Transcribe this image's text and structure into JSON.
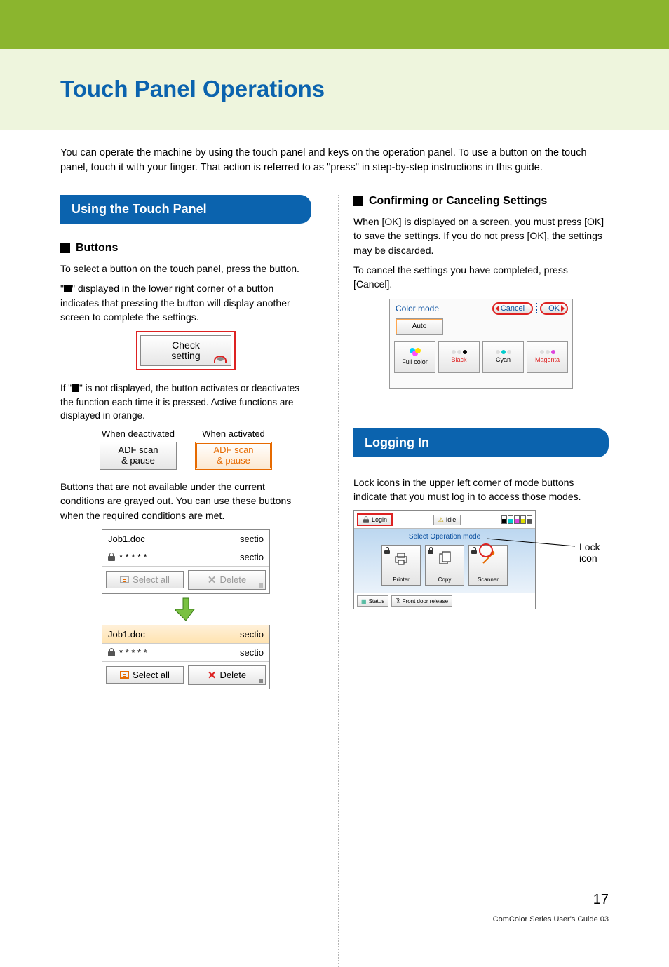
{
  "page_title": "Touch Panel Operations",
  "intro": "You can operate the machine by using the touch panel and keys on the operation panel. To use a button on the touch panel, touch it with your finger. That action is referred to as \"press\" in step-by-step instructions in this guide.",
  "left": {
    "section_title": "Using the Touch Panel",
    "buttons_heading": "Buttons",
    "p1": "To select a button on the touch panel, press the button.",
    "p2a": "\"",
    "p2b": "\" displayed in the lower right corner of a button indicates that pressing the button will display another screen to complete the settings.",
    "check_setting_l1": "Check",
    "check_setting_l2": "setting",
    "p3a": "If \"",
    "p3b": "\" is not displayed, the button activates or deactivates the function each time it is pressed. Active functions are displayed in orange.",
    "deactivated_label": "When deactivated",
    "activated_label": "When activated",
    "adf_l1": "ADF scan",
    "adf_l2": "& pause",
    "p4": "Buttons that are not available under the current conditions are grayed out. You can use these buttons when the required conditions are met.",
    "job1": "Job1.doc",
    "masked": "* * * * *",
    "section_label": "sectio",
    "select_all": "Select all",
    "delete": "Delete"
  },
  "right": {
    "confirm_heading": "Confirming or Canceling Settings",
    "confirm_p1": "When [OK] is displayed on a screen, you must press [OK] to save the settings. If you do not press [OK], the settings may be discarded.",
    "confirm_p2": "To cancel the settings you have completed, press [Cancel].",
    "color_mode": "Color mode",
    "cancel": "Cancel",
    "ok": "OK",
    "auto": "Auto",
    "full_color": "Full color",
    "black": "Black",
    "cyan": "Cyan",
    "magenta": "Magenta",
    "logging_in": "Logging In",
    "logging_p": "Lock icons in the upper left corner of mode buttons indicate that you must log in to access those modes.",
    "login": "Login",
    "idle": "Idle",
    "select_mode": "Select Operation mode",
    "printer": "Printer",
    "copy": "Copy",
    "scanner": "Scanner",
    "status": "Status",
    "front_door": "Front door release",
    "lock_icon_label": "Lock icon"
  },
  "page_number": "17",
  "footer": "ComColor Series User's Guide 03"
}
